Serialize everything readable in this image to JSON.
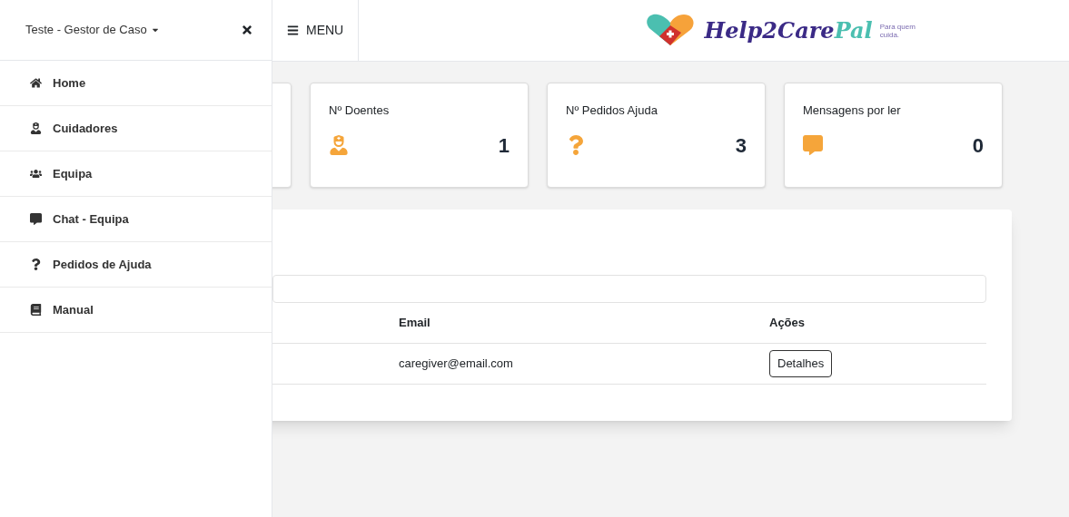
{
  "sidebar": {
    "user": "Teste - Gestor de Caso",
    "items": [
      {
        "label": "Home"
      },
      {
        "label": "Cuidadores"
      },
      {
        "label": "Equipa"
      },
      {
        "label": "Chat - Equipa"
      },
      {
        "label": "Pedidos de Ajuda"
      },
      {
        "label": "Manual"
      }
    ]
  },
  "header": {
    "menu": "MENU",
    "logo": {
      "name_part_1": "Help2Care",
      "name_part_2": "Pal",
      "tagline": "Para quem cuida."
    }
  },
  "stats": [
    {
      "label": "Nº Doentes",
      "value": "1"
    },
    {
      "label": "Nº Pedidos Ajuda",
      "value": "3"
    },
    {
      "label": "Mensagens por ler",
      "value": "0"
    }
  ],
  "table": {
    "columns": [
      "Email",
      "Ações"
    ],
    "rows": [
      {
        "email": "caregiver@email.com",
        "action": "Detalhes"
      }
    ]
  }
}
